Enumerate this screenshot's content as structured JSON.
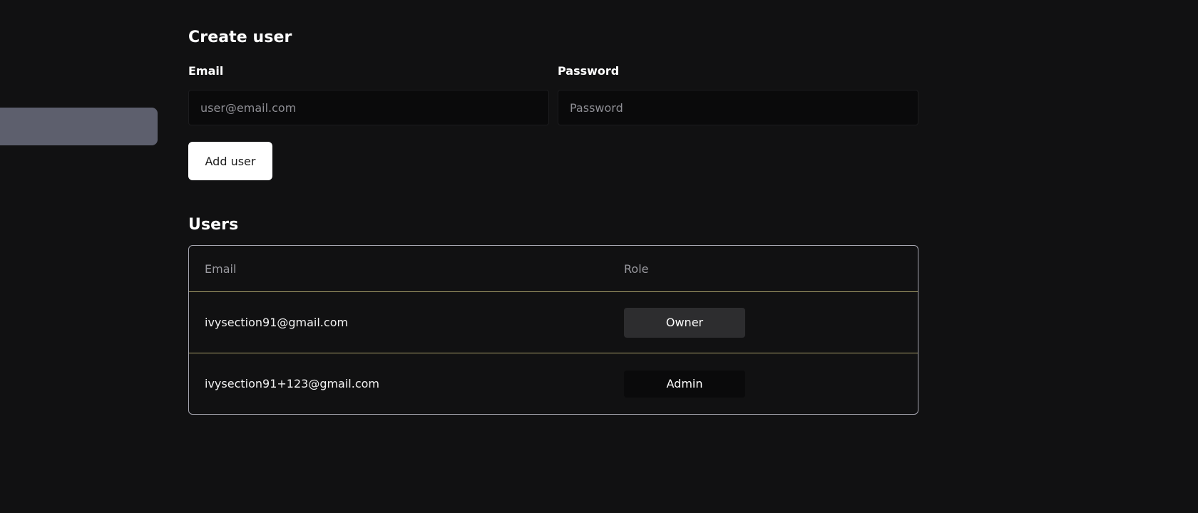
{
  "create_user": {
    "title": "Create user",
    "email_label": "Email",
    "email_placeholder": "user@email.com",
    "email_value": "",
    "password_label": "Password",
    "password_placeholder": "Password",
    "password_value": "",
    "add_button_label": "Add user"
  },
  "users": {
    "title": "Users",
    "columns": [
      "Email",
      "Role"
    ],
    "rows": [
      {
        "email": "ivysection91@gmail.com",
        "role": "Owner"
      },
      {
        "email": "ivysection91+123@gmail.com",
        "role": "Admin"
      }
    ]
  },
  "colors": {
    "background": "#111112",
    "sidebar_highlight": "#5d5f6d",
    "button_bg": "#ffffff",
    "table_border": "#a6a6b0",
    "row_divider": "#a89f6a"
  }
}
